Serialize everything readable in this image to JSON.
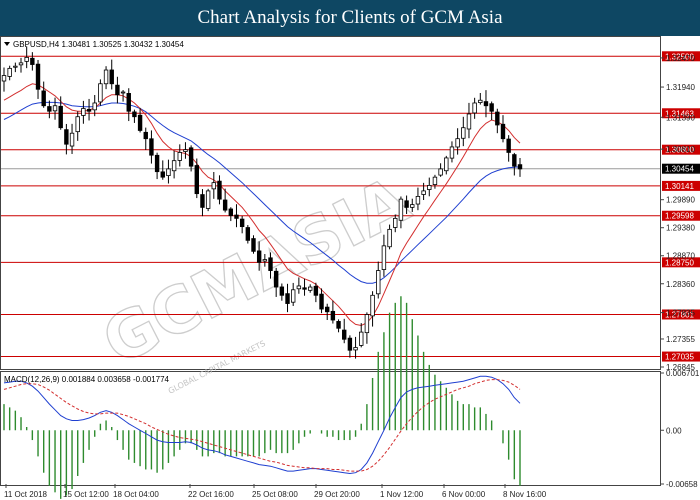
{
  "banner": {
    "title": "Chart Analysis for Clients of GCM Asia"
  },
  "watermark": {
    "brand": "GCMASIA",
    "sub": "GLOBAL CAPITAL MARKETS"
  },
  "colors": {
    "banner": "#0e4763",
    "level_line": "#cc0000",
    "ma_fast": "#d32f2f",
    "ma_slow": "#1f3fd0",
    "macd_main": "#1f3fd0",
    "macd_signal": "#d32f2f",
    "hist": "#2e8b2e",
    "current_price": "#000000"
  },
  "chart_data": [
    {
      "type": "candlestick",
      "header": "GBPUSD,H4  1.30481 1.30525 1.30432 1.30454",
      "ylim": [
        1.26845,
        1.3276
      ],
      "y_ticks": [
        "1.32470",
        "1.31940",
        "1.31390",
        "1.30810",
        "1.29890",
        "1.29380",
        "1.28870",
        "1.28360",
        "1.27835",
        "1.27355",
        "1.26845"
      ],
      "x_ticks": [
        "11 Oct 2018",
        "15 Oct 12:00",
        "18 Oct 04:00",
        "22 Oct 16:00",
        "25 Oct 08:00",
        "29 Oct 20:00",
        "1 Nov 12:00",
        "6 Nov 00:00",
        "8 Nov 16:00"
      ],
      "levels": [
        {
          "value": 1.325,
          "label": "1.32500"
        },
        {
          "value": 1.31463,
          "label": "1.31463"
        },
        {
          "value": 1.308,
          "label": "1.30800"
        },
        {
          "value": 1.30141,
          "label": "1.30141"
        },
        {
          "value": 1.29598,
          "label": "1.29598"
        },
        {
          "value": 1.2875,
          "label": "1.28750"
        },
        {
          "value": 1.27801,
          "label": "1.27801"
        },
        {
          "value": 1.27035,
          "label": "1.27035"
        }
      ],
      "current_price": {
        "value": 1.30454,
        "label": "1.30454"
      },
      "close_path": [
        1.3215,
        1.3228,
        1.3232,
        1.3238,
        1.3248,
        1.3235,
        1.319,
        1.316,
        1.315,
        1.316,
        1.312,
        1.309,
        1.311,
        1.314,
        1.3155,
        1.315,
        1.3165,
        1.32,
        1.3225,
        1.32,
        1.318,
        1.3185,
        1.315,
        1.314,
        1.3115,
        1.31,
        1.307,
        1.304,
        1.303,
        1.3045,
        1.306,
        1.3075,
        1.308,
        1.305,
        1.3,
        1.2975,
        1.3005,
        1.302,
        1.299,
        1.297,
        1.296,
        1.2955,
        1.294,
        1.2915,
        1.2895,
        1.2875,
        1.288,
        1.286,
        1.283,
        1.2815,
        1.28,
        1.2825,
        1.2832,
        1.2826,
        1.283,
        1.2815,
        1.279,
        1.2785,
        1.277,
        1.2755,
        1.2735,
        1.2715,
        1.272,
        1.2748,
        1.278,
        1.2815,
        1.286,
        1.2905,
        1.2935,
        1.2955,
        1.299,
        1.2975,
        1.298,
        1.2995,
        1.3005,
        1.3015,
        1.303,
        1.3045,
        1.3065,
        1.3085,
        1.31,
        1.312,
        1.3145,
        1.3165,
        1.317,
        1.316,
        1.315,
        1.3125,
        1.31,
        1.3075,
        1.305,
        1.3045
      ],
      "ma_fast": [
        1.317,
        1.3176,
        1.3182,
        1.3188,
        1.3195,
        1.32,
        1.3198,
        1.3192,
        1.3185,
        1.3178,
        1.3168,
        1.3158,
        1.3152,
        1.315,
        1.315,
        1.3152,
        1.3156,
        1.3165,
        1.3175,
        1.318,
        1.318,
        1.3178,
        1.3172,
        1.3165,
        1.3155,
        1.3143,
        1.3128,
        1.311,
        1.3095,
        1.3085,
        1.3078,
        1.3075,
        1.3073,
        1.3067,
        1.3055,
        1.304,
        1.303,
        1.3025,
        1.3017,
        1.3005,
        1.2995,
        1.2985,
        1.2975,
        1.2962,
        1.2948,
        1.2933,
        1.2922,
        1.2908,
        1.2893,
        1.2878,
        1.2863,
        1.2855,
        1.285,
        1.2845,
        1.2841,
        1.2835,
        1.2825,
        1.2815,
        1.2805,
        1.2795,
        1.2783,
        1.277,
        1.2762,
        1.276,
        1.2765,
        1.2777,
        1.2795,
        1.2818,
        1.2842,
        1.2866,
        1.2892,
        1.291,
        1.2926,
        1.2942,
        1.2958,
        1.2973,
        1.2988,
        1.3003,
        1.3018,
        1.3034,
        1.305,
        1.3067,
        1.3085,
        1.3103,
        1.3118,
        1.3128,
        1.3134,
        1.3131,
        1.3125,
        1.3115,
        1.3102,
        1.3092
      ],
      "ma_slow": [
        1.3135,
        1.314,
        1.3146,
        1.3152,
        1.3158,
        1.3163,
        1.3165,
        1.3166,
        1.3166,
        1.3166,
        1.3165,
        1.3163,
        1.316,
        1.3159,
        1.3158,
        1.3158,
        1.3158,
        1.316,
        1.3163,
        1.3165,
        1.3165,
        1.3164,
        1.3162,
        1.3159,
        1.3155,
        1.3149,
        1.3141,
        1.3132,
        1.3124,
        1.3117,
        1.3111,
        1.3106,
        1.3101,
        1.3096,
        1.3088,
        1.3079,
        1.3071,
        1.3064,
        1.3056,
        1.3047,
        1.3038,
        1.3029,
        1.302,
        1.301,
        1.3,
        1.299,
        1.298,
        1.297,
        1.296,
        1.295,
        1.294,
        1.2932,
        1.2925,
        1.2918,
        1.2911,
        1.2903,
        1.2895,
        1.2887,
        1.2879,
        1.287,
        1.2862,
        1.2853,
        1.2846,
        1.284,
        1.2837,
        1.2837,
        1.284,
        1.2847,
        1.2856,
        1.2866,
        1.2877,
        1.2887,
        1.2897,
        1.2907,
        1.2917,
        1.2927,
        1.2937,
        1.2947,
        1.2957,
        1.2968,
        1.2979,
        1.299,
        1.3002,
        1.3013,
        1.3024,
        1.3032,
        1.3038,
        1.3042,
        1.3045,
        1.3047,
        1.3048,
        1.3049
      ]
    },
    {
      "type": "line",
      "title": "MACD(12,26,9) 0.001884 0.003658 -0.001774",
      "ylim": [
        -0.00658,
        0.00701
      ],
      "y_ticks": [
        {
          "value": 0.00701,
          "label": "0.006701"
        },
        {
          "value": 0.0,
          "label": "0.00"
        },
        {
          "value": -0.00658,
          "label": "-0.00658"
        }
      ],
      "main": [
        0.0058,
        0.0059,
        0.006,
        0.006,
        0.0058,
        0.0054,
        0.0048,
        0.004,
        0.0032,
        0.0025,
        0.0018,
        0.0014,
        0.0012,
        0.0012,
        0.0013,
        0.0015,
        0.0018,
        0.0022,
        0.0024,
        0.0022,
        0.0018,
        0.0013,
        0.0008,
        0.0004,
        0.0,
        -0.0004,
        -0.0008,
        -0.0012,
        -0.0014,
        -0.0015,
        -0.0015,
        -0.0015,
        -0.0014,
        -0.0015,
        -0.0018,
        -0.0022,
        -0.0024,
        -0.0025,
        -0.0027,
        -0.003,
        -0.0032,
        -0.0034,
        -0.0036,
        -0.0038,
        -0.004,
        -0.0042,
        -0.0043,
        -0.0044,
        -0.0046,
        -0.0048,
        -0.005,
        -0.005,
        -0.0049,
        -0.0048,
        -0.0047,
        -0.0047,
        -0.0048,
        -0.0049,
        -0.005,
        -0.0051,
        -0.0052,
        -0.0053,
        -0.0052,
        -0.0048,
        -0.004,
        -0.0028,
        -0.0014,
        0.0,
        0.0015,
        0.0028,
        0.004,
        0.0047,
        0.005,
        0.0052,
        0.0053,
        0.0054,
        0.0055,
        0.0056,
        0.0057,
        0.0058,
        0.0059,
        0.006,
        0.0062,
        0.0064,
        0.0066,
        0.0066,
        0.0065,
        0.0062,
        0.0057,
        0.005,
        0.004,
        0.0033
      ],
      "signal": [
        0.005,
        0.0052,
        0.0054,
        0.0056,
        0.0057,
        0.0057,
        0.0056,
        0.0053,
        0.0049,
        0.0044,
        0.0039,
        0.0034,
        0.003,
        0.0026,
        0.0023,
        0.0021,
        0.002,
        0.002,
        0.0021,
        0.0021,
        0.0021,
        0.0019,
        0.0017,
        0.0014,
        0.0011,
        0.0008,
        0.0004,
        0.0001,
        -0.0002,
        -0.0005,
        -0.0007,
        -0.0009,
        -0.001,
        -0.0011,
        -0.0012,
        -0.0014,
        -0.0016,
        -0.0018,
        -0.002,
        -0.0022,
        -0.0024,
        -0.0026,
        -0.0028,
        -0.003,
        -0.0032,
        -0.0034,
        -0.0036,
        -0.0038,
        -0.0039,
        -0.0041,
        -0.0043,
        -0.0044,
        -0.0045,
        -0.0046,
        -0.0046,
        -0.0047,
        -0.0047,
        -0.0047,
        -0.0048,
        -0.0048,
        -0.0049,
        -0.005,
        -0.005,
        -0.005,
        -0.0048,
        -0.0044,
        -0.0038,
        -0.003,
        -0.0021,
        -0.0011,
        -0.0001,
        0.0008,
        0.0016,
        0.0023,
        0.0029,
        0.0034,
        0.0038,
        0.0041,
        0.0044,
        0.0047,
        0.005,
        0.0052,
        0.0054,
        0.0057,
        0.0059,
        0.0061,
        0.0062,
        0.0062,
        0.0061,
        0.0059,
        0.0055,
        0.005
      ]
    }
  ]
}
